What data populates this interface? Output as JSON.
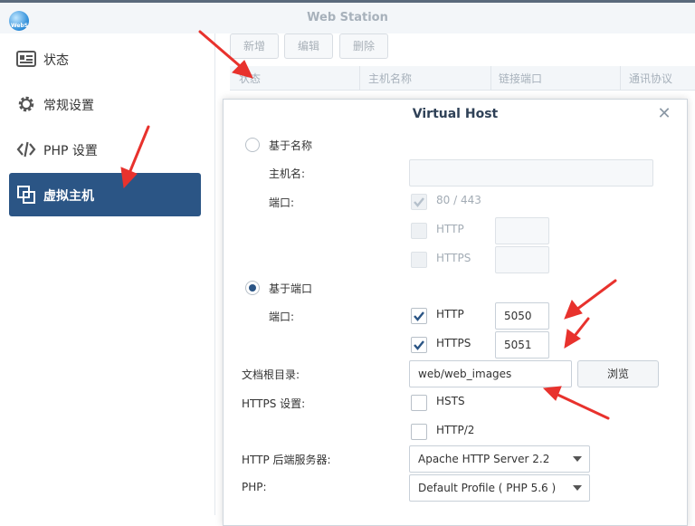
{
  "app": {
    "title": "Web Station",
    "logo_text": "WebS"
  },
  "sidebar": {
    "items": [
      {
        "label": "状态",
        "icon": "status-icon"
      },
      {
        "label": "常规设置",
        "icon": "gear-icon"
      },
      {
        "label": "PHP 设置",
        "icon": "code-icon"
      },
      {
        "label": "虚拟主机",
        "icon": "virtual-host-icon",
        "active": true
      }
    ]
  },
  "toolbar": {
    "add_label": "新增",
    "edit_label": "编辑",
    "delete_label": "删除"
  },
  "grid": {
    "columns": [
      "状态",
      "主机名称",
      "链接端口",
      "通讯协议"
    ]
  },
  "dialog": {
    "title": "Virtual Host",
    "name_based": {
      "label": "基于名称",
      "selected": false,
      "hostname_label": "主机名:",
      "hostname_value": "",
      "port_label": "端口:",
      "default_port_label": "80 / 443",
      "http_label": "HTTP",
      "https_label": "HTTPS"
    },
    "port_based": {
      "label": "基于端口",
      "selected": true,
      "port_label": "端口:",
      "http_label": "HTTP",
      "http_checked": true,
      "http_port": "5050",
      "https_label": "HTTPS",
      "https_checked": true,
      "https_port": "5051"
    },
    "doc_root": {
      "label": "文档根目录:",
      "value": "web/web_images",
      "browse_label": "浏览"
    },
    "https_settings": {
      "label": "HTTPS 设置:",
      "hsts_label": "HSTS",
      "http2_label": "HTTP/2"
    },
    "backend": {
      "label": "HTTP 后端服务器:",
      "value": "Apache HTTP Server 2.2"
    },
    "php": {
      "label": "PHP:",
      "value": "Default Profile ( PHP 5.6 )"
    }
  },
  "colors": {
    "accent": "#2b5585",
    "annotation_arrow": "#e8322d"
  }
}
